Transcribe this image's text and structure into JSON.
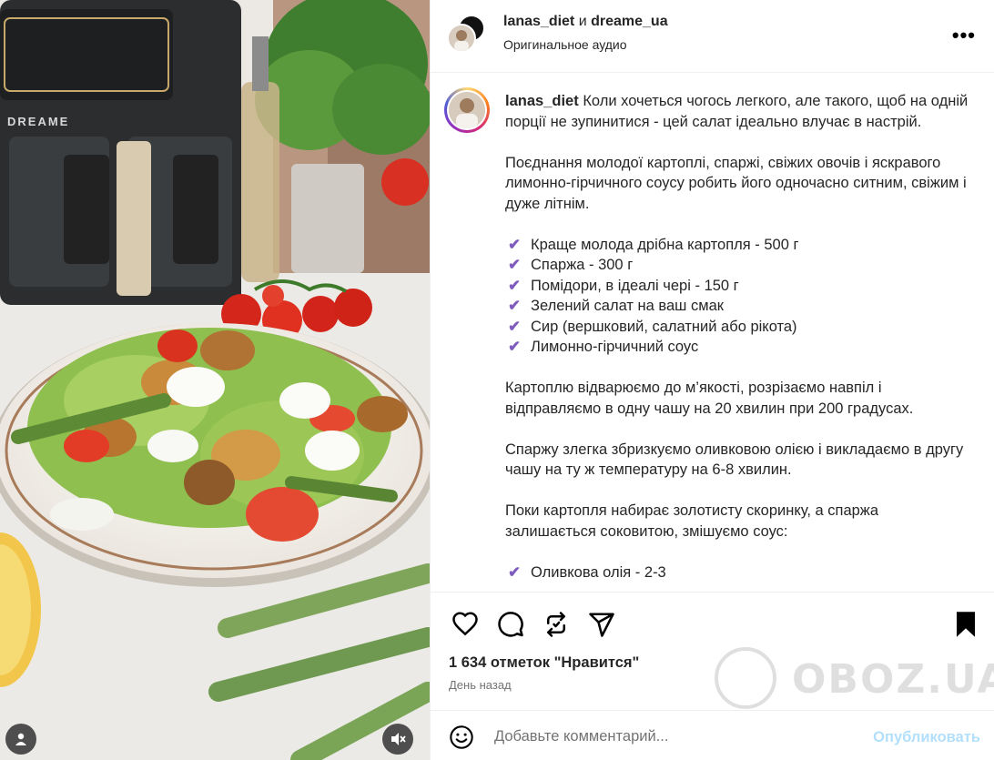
{
  "header": {
    "user1": "lanas_diet",
    "conjunction": "и",
    "user2": "dreame_ua",
    "audio": "Оригинальное аудио",
    "more": "•••"
  },
  "media": {
    "brand": "DREAME"
  },
  "caption": {
    "username": "lanas_diet",
    "intro": "Коли хочеться чогось легкого, але такого, щоб на одній порції не зупинитися - цей салат ідеально влучає в настрій.",
    "para2": "Поєднання молодої картоплі, спаржі, свіжих овочів і яскравого лимонно-гірчичного соусу робить його одночасно ситним, свіжим і дуже літнім.",
    "check_symbol": "✔",
    "ingredients": [
      "Краще молода дрібна картопля - 500 г",
      "Спаржа - 300 г",
      "Помідори, в ідеалі чері - 150 г",
      "Зелений салат на ваш смак",
      "Сир (вершковий, салатний або рікота)",
      "Лимонно-гірчичний соус"
    ],
    "para3": "Картоплю відварюємо до м’якості, розрізаємо навпіл і відправляємо в одну чашу на 20 хвилин при 200 градусах.",
    "para4": "Спаржу злегка збризкуємо оливковою олією і викладаємо в другу чашу на ту ж температуру на 6-8 хвилин.",
    "para5": "Поки картопля набирає золотисту скоринку, а спаржа залишається соковитою, змішуємо соус:",
    "partial_item": "Оливкова олія - 2-3"
  },
  "actions": {
    "likes": "1 634 отметок \"Нравится\"",
    "date": "День назад"
  },
  "watermark": {
    "text": "OBOZ.UA"
  },
  "comment": {
    "placeholder": "Добавьте комментарий...",
    "publish": "Опубликовать"
  },
  "colors": {
    "check": "#7e5bbd",
    "publish": "#b2dffc",
    "muted": "#737373"
  }
}
